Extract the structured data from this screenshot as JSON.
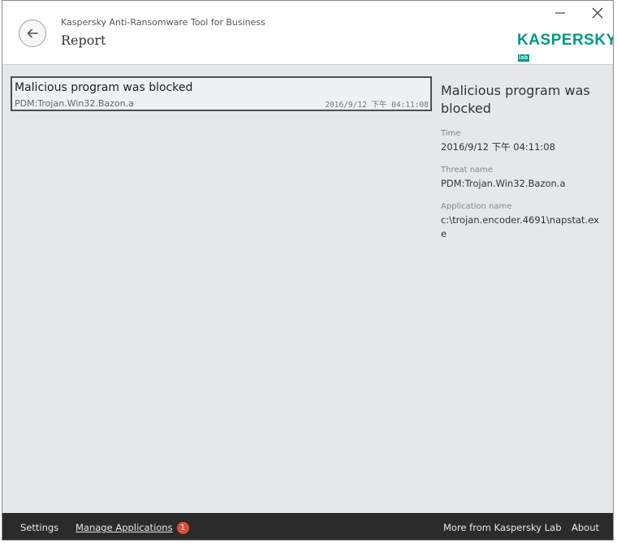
{
  "header": {
    "app_name": "Kaspersky Anti-Ransomware Tool for Business",
    "page_title": "Report",
    "logo_text": "KASPERSKY",
    "logo_lab": "lab"
  },
  "events": [
    {
      "title": "Malicious program was blocked",
      "threat": "PDM:Trojan.Win32.Bazon.a",
      "time": "2016/9/12 下午 04:11:08"
    }
  ],
  "details": {
    "title": "Malicious program was blocked",
    "time_label": "Time",
    "time_value": "2016/9/12 下午 04:11:08",
    "threat_label": "Threat name",
    "threat_value": "PDM:Trojan.Win32.Bazon.a",
    "app_label": "Application name",
    "app_value": "c:\\trojan.encoder.4691\\napstat.exe"
  },
  "footer": {
    "settings": "Settings",
    "manage_apps": "Manage Applications",
    "manage_apps_badge": "1",
    "more": "More from Kaspersky Lab",
    "about": "About"
  },
  "icons": {
    "back": "arrow-left-icon",
    "minimize": "minimize-icon",
    "close": "close-icon"
  },
  "colors": {
    "brand": "#009982",
    "badge": "#e04a3a",
    "footer_bg": "#2b2b2b",
    "content_bg": "#e4e8ea"
  }
}
